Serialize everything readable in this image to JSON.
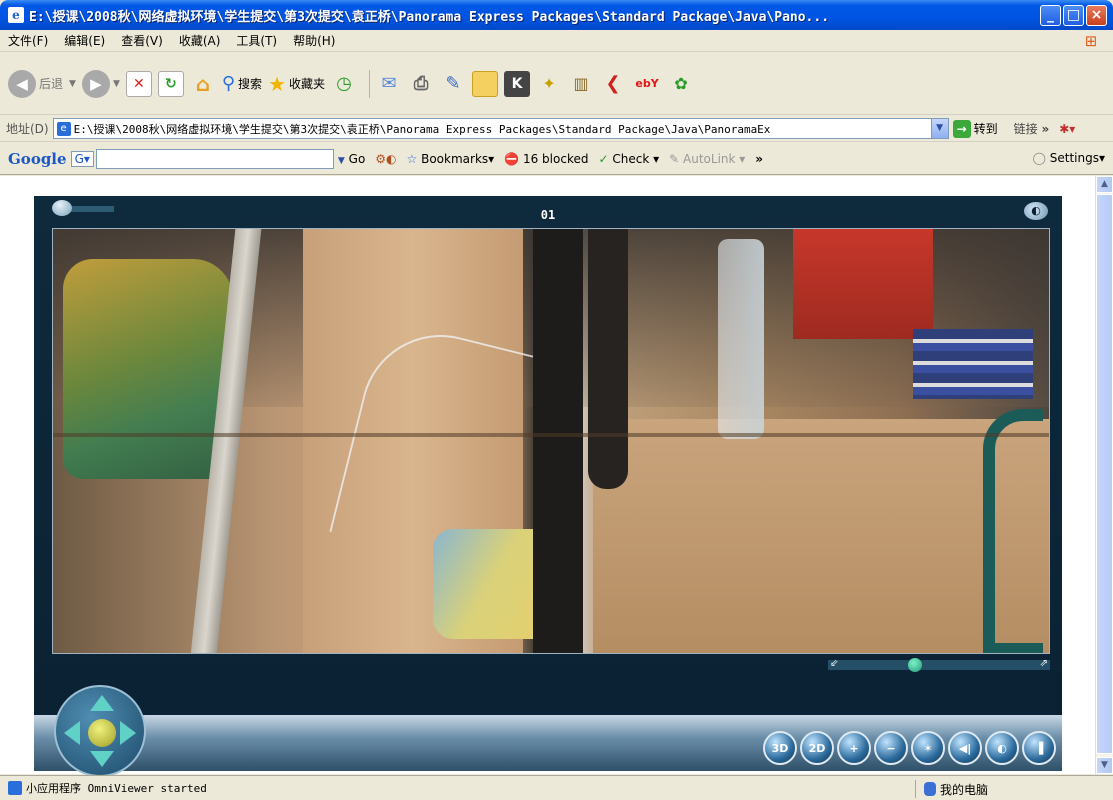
{
  "window": {
    "title": "E:\\授课\\2008秋\\网络虚拟环境\\学生提交\\第3次提交\\袁正桥\\Panorama Express Packages\\Standard Package\\Java\\Pano...",
    "minimize": "_",
    "maximize": "□",
    "close": "×"
  },
  "menu": {
    "items": [
      "文件(F)",
      "编辑(E)",
      "查看(V)",
      "收藏(A)",
      "工具(T)",
      "帮助(H)"
    ]
  },
  "toolbar": {
    "back_label": "后退",
    "search_label": "搜索",
    "favorites_label": "收藏夹"
  },
  "address": {
    "label": "地址(D)",
    "value": "E:\\授课\\2008秋\\网络虚拟环境\\学生提交\\第3次提交\\袁正桥\\Panorama Express Packages\\Standard Package\\Java\\PanoramaEx",
    "go_label": "转到",
    "links_label": "链接"
  },
  "google": {
    "logo": "Google",
    "go_label": "Go",
    "bookmarks_label": "Bookmarks",
    "blocked_label": "16 blocked",
    "check_label": "Check",
    "autolink_label": "AutoLink",
    "settings_label": "Settings"
  },
  "viewer": {
    "frame_number": "01",
    "controls": [
      "3D",
      "2D",
      "+",
      "−",
      "✶",
      "◀|",
      "◐",
      "▐"
    ]
  },
  "status": {
    "text": "小应用程序 OmniViewer started",
    "zone": "我的电脑"
  },
  "colors": {
    "titlebar": "#0054e3",
    "viewer_bg": "#0e2a3d",
    "chrome": "#ece9d8"
  }
}
